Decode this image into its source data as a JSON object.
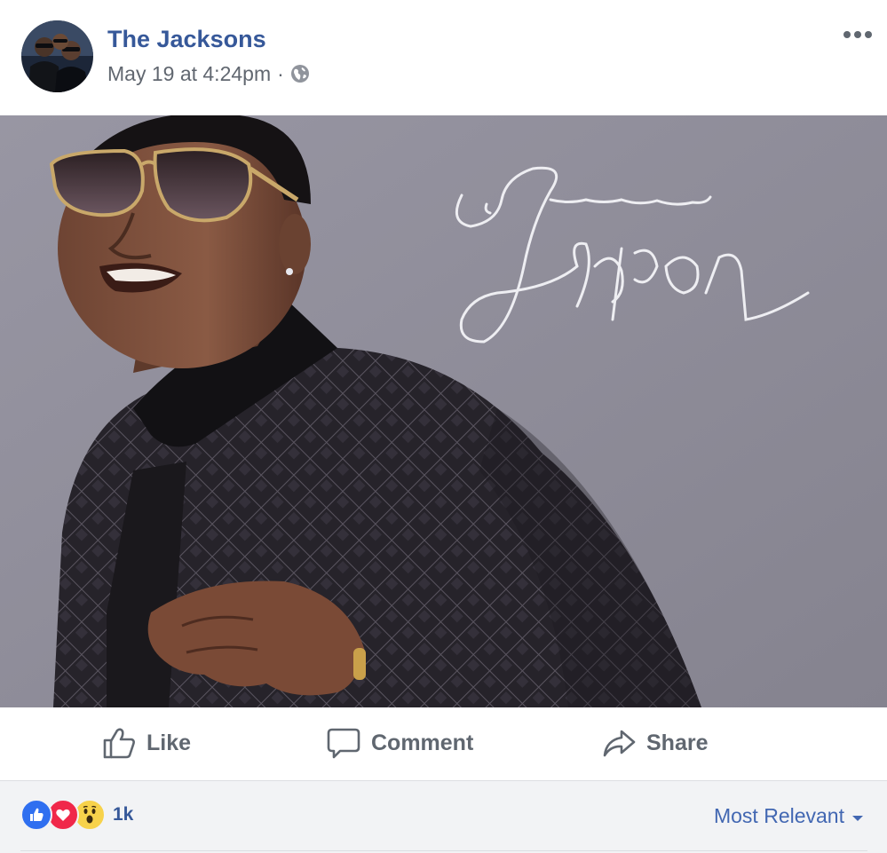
{
  "post": {
    "page_name": "The Jacksons",
    "timestamp": "May 19 at 4:24pm",
    "separator": "·",
    "privacy_icon": "globe-icon",
    "more_icon": "more-horizontal-icon"
  },
  "photo": {
    "signature_text": "Jermaine Jackson",
    "background_color": "#8e8c99"
  },
  "actions": {
    "like_label": "Like",
    "comment_label": "Comment",
    "share_label": "Share"
  },
  "reactions": {
    "types": [
      "like",
      "love",
      "wow"
    ],
    "count": "1k",
    "sort_label": "Most Relevant"
  },
  "colors": {
    "link_blue": "#365899",
    "action_gray": "#606770",
    "footer_bg": "#f2f3f5"
  }
}
